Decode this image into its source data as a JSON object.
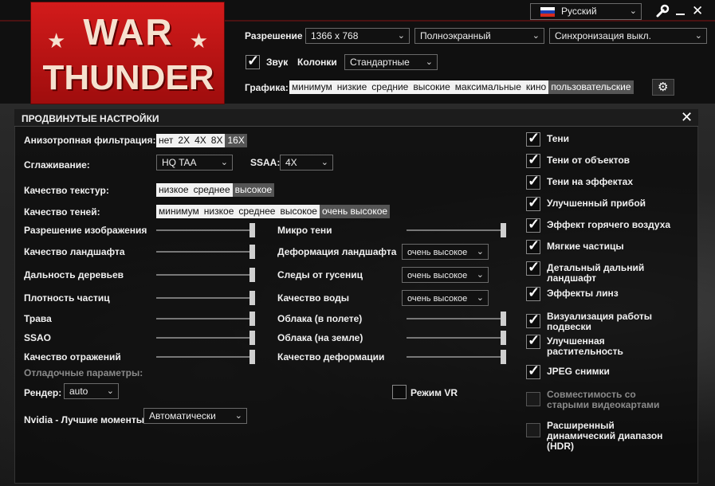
{
  "header": {
    "language": "Русский",
    "resolution_label": "Разрешение",
    "resolution_value": "1366 x 768",
    "display_mode": "Полноэкранный",
    "vsync": "Синхронизация выкл.",
    "sound_label": "Звук",
    "speakers_label": "Колонки",
    "speakers_value": "Стандартные",
    "graphics_label": "Графика:",
    "graphics_presets": [
      "минимум",
      "низкие",
      "средние",
      "высокие",
      "максимальные",
      "кино",
      "пользовательские"
    ],
    "graphics_selected_index": 6,
    "logo_top": "WAR",
    "logo_bottom": "THUNDER"
  },
  "panel": {
    "title": "ПРОДВИНУТЫЕ НАСТРОЙКИ",
    "aniso_label": "Анизотропная фильтрация:",
    "aniso_options": [
      "нет",
      "2X",
      "4X",
      "8X",
      "16X"
    ],
    "aniso_selected_index": 4,
    "aa_label": "Сглаживание:",
    "aa_value": "HQ TAA",
    "ssaa_label": "SSAA:",
    "ssaa_value": "4X",
    "texture_label": "Качество текстур:",
    "texture_options": [
      "низкое",
      "среднее",
      "высокое"
    ],
    "texture_selected_index": 2,
    "shadow_label": "Качество теней:",
    "shadow_options": [
      "минимум",
      "низкое",
      "среднее",
      "высокое",
      "очень высокое"
    ],
    "shadow_selected_index": 4,
    "left_sliders": [
      {
        "label": "Разрешение изображения",
        "level": 1.0
      },
      {
        "label": "Качество ландшафта",
        "level": 1.0
      },
      {
        "label": "Дальность деревьев",
        "level": 1.0
      },
      {
        "label": "Плотность частиц",
        "level": 1.0
      },
      {
        "label": "Трава",
        "level": 1.0
      },
      {
        "label": "SSAO",
        "level": 1.0
      },
      {
        "label": "Качество отражений",
        "level": 1.0
      }
    ],
    "mid_items": [
      {
        "label": "Микро тени",
        "type": "slider",
        "level": 1.0
      },
      {
        "label": "Деформация ландшафта",
        "type": "select",
        "value": "очень высокое"
      },
      {
        "label": "Следы от гусениц",
        "type": "select",
        "value": "очень высокое"
      },
      {
        "label": "Качество воды",
        "type": "select",
        "value": "очень высокое"
      },
      {
        "label": "Облака (в полете)",
        "type": "slider",
        "level": 1.0
      },
      {
        "label": "Облака (на земле)",
        "type": "slider",
        "level": 1.0
      },
      {
        "label": "Качество деформации",
        "type": "slider",
        "level": 1.0
      }
    ],
    "debug_label": "Отладочные параметры:",
    "render_label": "Рендер:",
    "render_value": "auto",
    "vr_label": "Режим VR",
    "vr_checked": false,
    "nvidia_label": "Nvidia - Лучшие моменты:",
    "nvidia_value": "Автоматически",
    "right_checks": [
      {
        "label": "Тени",
        "checked": true
      },
      {
        "label": "Тени от объектов",
        "checked": true
      },
      {
        "label": "Тени на эффектах",
        "checked": true
      },
      {
        "label": "Улучшенный прибой",
        "checked": true
      },
      {
        "label": "Эффект горячего воздуха",
        "checked": true
      },
      {
        "label": "Мягкие частицы",
        "checked": true
      },
      {
        "label": "Детальный дальний ландшафт",
        "checked": true
      },
      {
        "label": "Эффекты линз",
        "checked": true
      },
      {
        "label": "Визуализация работы подвески",
        "checked": true
      },
      {
        "label": "Улучшенная растительность",
        "checked": true
      },
      {
        "label": "JPEG снимки",
        "checked": true
      },
      {
        "label": "Совместимость со старыми видеокартами",
        "checked": false,
        "disabled": true
      },
      {
        "label": "Расширенный динамический диапазон (HDR)",
        "checked": false
      }
    ]
  },
  "icons": {
    "wrench": "wrench-icon",
    "minimize": "minimize-icon",
    "close": "close-icon",
    "gear": "gear-icon"
  }
}
